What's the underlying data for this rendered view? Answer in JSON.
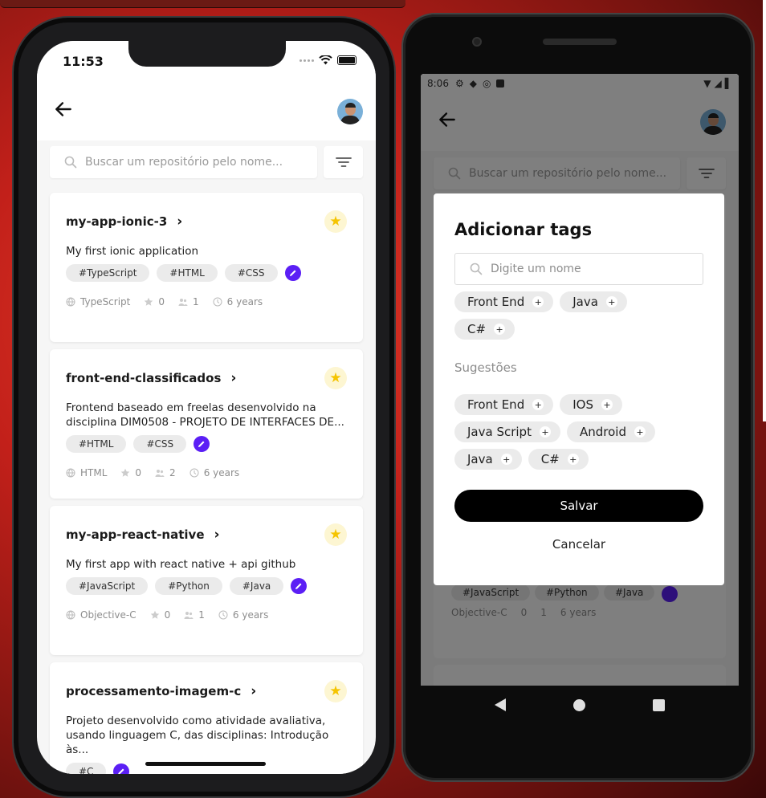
{
  "ios": {
    "time": "11:53",
    "search_placeholder": "Buscar um repositório pelo nome...",
    "repos": [
      {
        "name": "my-app-ionic-3",
        "description": "My first ionic application",
        "tags": [
          "#TypeScript",
          "#HTML",
          "#CSS"
        ],
        "language": "TypeScript",
        "stars": "0",
        "contributors": "1",
        "age": "6 years"
      },
      {
        "name": "front-end-classificados",
        "description": "Frontend baseado em freelas desenvolvido na disciplina DIM0508 - PROJETO DE INTERFACES DE...",
        "tags": [
          "#HTML",
          "#CSS"
        ],
        "language": "HTML",
        "stars": "0",
        "contributors": "2",
        "age": "6 years"
      },
      {
        "name": "my-app-react-native",
        "description": "My first app with react native + api github",
        "tags": [
          "#JavaScript",
          "#Python",
          "#Java"
        ],
        "language": "Objective-C",
        "stars": "0",
        "contributors": "1",
        "age": "6 years"
      },
      {
        "name": "processamento-imagem-c",
        "description": "Projeto desenvolvido como atividade avaliativa, usando linguagem C, das disciplinas: Introdução às...",
        "tags": [
          "#C"
        ]
      }
    ]
  },
  "android": {
    "time": "8:06",
    "bg": {
      "search_placeholder": "Buscar um repositório pelo nome...",
      "tags": [
        "#JavaScript",
        "#Python",
        "#Java"
      ],
      "language": "Objective-C",
      "stars": "0",
      "contributors": "1",
      "age": "6 years"
    },
    "modal": {
      "title": "Adicionar tags",
      "input_placeholder": "Digite um nome",
      "selected_tags": [
        "Front End",
        "Java",
        "C#"
      ],
      "suggestions_label": "Sugestões",
      "suggestions": [
        "Front End",
        "IOS",
        "Java Script",
        "Android",
        "Java",
        "C#"
      ],
      "save_label": "Salvar",
      "cancel_label": "Cancelar"
    }
  },
  "colors": {
    "accent_purple": "#5b1ff5",
    "star_yellow": "#f5c400"
  },
  "icons": [
    "back-arrow-icon",
    "search-icon",
    "filter-icon",
    "star-icon",
    "chevron-right-icon",
    "edit-icon",
    "globe-icon",
    "people-icon",
    "clock-icon",
    "plus-icon"
  ]
}
